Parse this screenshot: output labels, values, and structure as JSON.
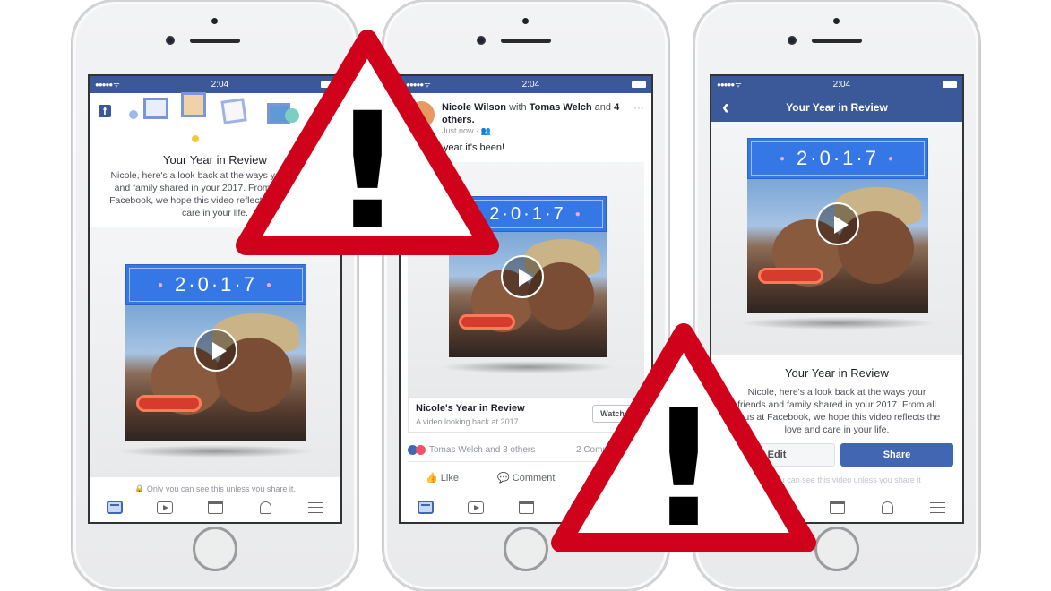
{
  "status_bar": {
    "time": "2:04",
    "signal": "●●●●● ᯤ"
  },
  "phone_left": {
    "logo": "f",
    "title": "Your Year in Review",
    "description": "Nicole, here's a look back at the ways your friends and family shared in your 2017. From all of us at Facebook, we hope this video reflects the love and care in your life.",
    "year_digits": [
      "2",
      "0",
      "1",
      "7"
    ],
    "privacy_note": "Only you can see this unless you share it."
  },
  "phone_middle": {
    "author": "Nicole Wilson",
    "with_text": "with",
    "tagged": "Tomas Welch",
    "and_text": "and",
    "others": "4 others.",
    "timestamp": "Just now · 👥",
    "post_text": "What a year it's been!",
    "year_digits": [
      "2",
      "0",
      "1",
      "7"
    ],
    "card_title": "Nicole's Year in Review",
    "card_subtitle": "A video looking back at 2017",
    "watch_button": "Watch Your",
    "reactions_text": "Tomas Welch and 3 others",
    "comments_count": "2 Comments",
    "like_label": "Like",
    "comment_label": "Comment",
    "more_icon": "···"
  },
  "phone_right": {
    "header_title": "Your Year in Review",
    "back_icon": "‹",
    "year_digits": [
      "2",
      "0",
      "1",
      "7"
    ],
    "title": "Your Year in Review",
    "description": "Nicole, here's a look back at the ways your friends and family shared in your 2017. From all of us at Facebook, we hope this video reflects the love and care in your life.",
    "edit_button": "Edit",
    "share_button": "Share",
    "privacy_note": "Only you can see this video unless you share it"
  },
  "warning_sign": {
    "symbol": "!",
    "color": "#d0021b"
  },
  "colors": {
    "facebook_blue": "#3b5998",
    "banner_blue": "#3578e5",
    "share_blue": "#4267b2"
  }
}
